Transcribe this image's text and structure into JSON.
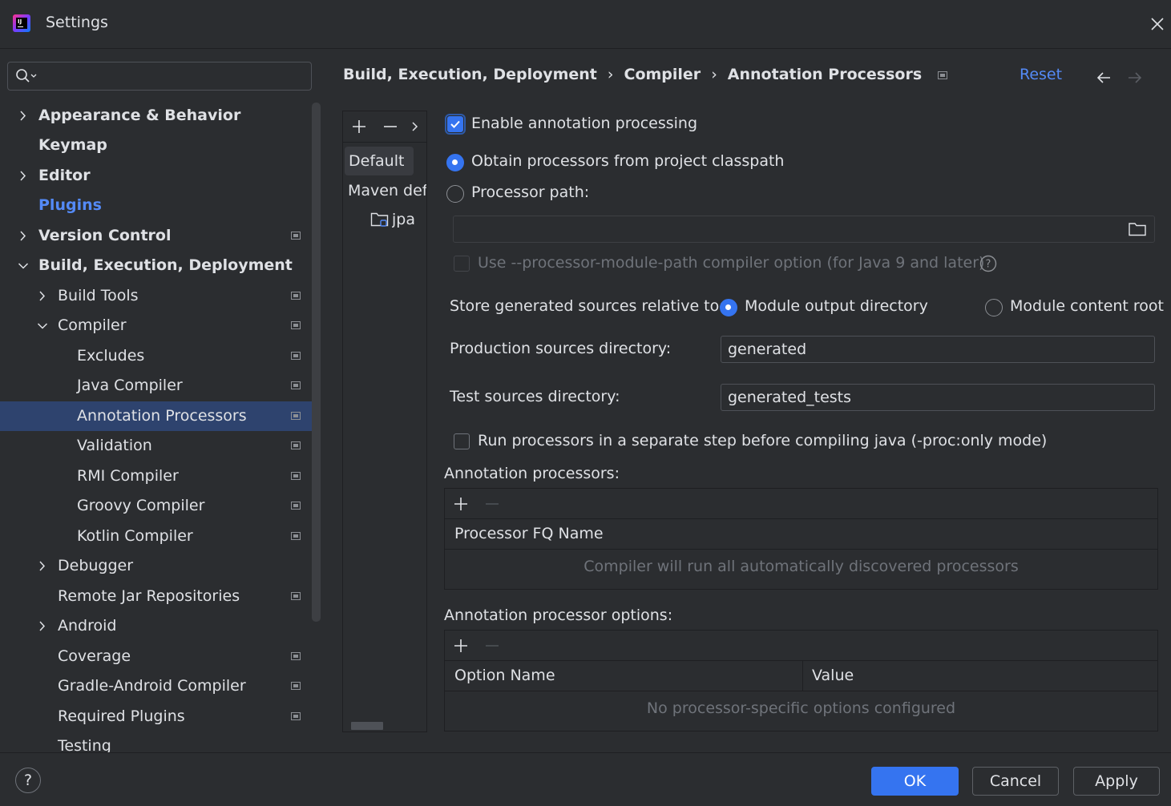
{
  "window": {
    "title": "Settings"
  },
  "search": {
    "placeholder": ""
  },
  "sidebar": {
    "items": [
      {
        "label": "Appearance & Behavior"
      },
      {
        "label": "Keymap"
      },
      {
        "label": "Editor"
      },
      {
        "label": "Plugins"
      },
      {
        "label": "Version Control"
      },
      {
        "label": "Build, Execution, Deployment"
      },
      {
        "label": "Build Tools"
      },
      {
        "label": "Compiler"
      },
      {
        "label": "Excludes"
      },
      {
        "label": "Java Compiler"
      },
      {
        "label": "Annotation Processors"
      },
      {
        "label": "Validation"
      },
      {
        "label": "RMI Compiler"
      },
      {
        "label": "Groovy Compiler"
      },
      {
        "label": "Kotlin Compiler"
      },
      {
        "label": "Debugger"
      },
      {
        "label": "Remote Jar Repositories"
      },
      {
        "label": "Android"
      },
      {
        "label": "Coverage"
      },
      {
        "label": "Gradle-Android Compiler"
      },
      {
        "label": "Required Plugins"
      },
      {
        "label": "Testing"
      }
    ]
  },
  "header": {
    "breadcrumb": [
      "Build, Execution, Deployment",
      "Compiler",
      "Annotation Processors"
    ],
    "separator": "›",
    "reset_label": "Reset"
  },
  "profiles": {
    "items": [
      "Default",
      "Maven default annotation processors profile",
      "jpa"
    ]
  },
  "main": {
    "enable_processing_label": "Enable annotation processing",
    "obtain_classpath_label": "Obtain processors from project classpath",
    "processor_path_label": "Processor path:",
    "processor_path_value": "",
    "module_path_option_label": "Use --processor-module-path compiler option (for Java 9 and later)",
    "store_relative_label": "Store generated sources relative to:",
    "module_output_label": "Module output directory",
    "module_content_label": "Module content root",
    "production_dir_label": "Production sources directory:",
    "production_dir_value": "generated",
    "test_dir_label": "Test sources directory:",
    "test_dir_value": "generated_tests",
    "separate_step_label": "Run processors in a separate step before compiling java (-proc:only mode)",
    "processors_section_label": "Annotation processors:",
    "processors_column": "Processor FQ Name",
    "processors_empty": "Compiler will run all automatically discovered processors",
    "options_section_label": "Annotation processor options:",
    "options_columns": [
      "Option Name",
      "Value"
    ],
    "options_empty": "No processor-specific options configured"
  },
  "footer": {
    "help_label": "?",
    "ok_label": "OK",
    "cancel_label": "Cancel",
    "apply_label": "Apply"
  },
  "colors": {
    "background": "#2b2d30",
    "accent": "#3574f0",
    "link": "#548af7",
    "selection": "#2e436e"
  }
}
